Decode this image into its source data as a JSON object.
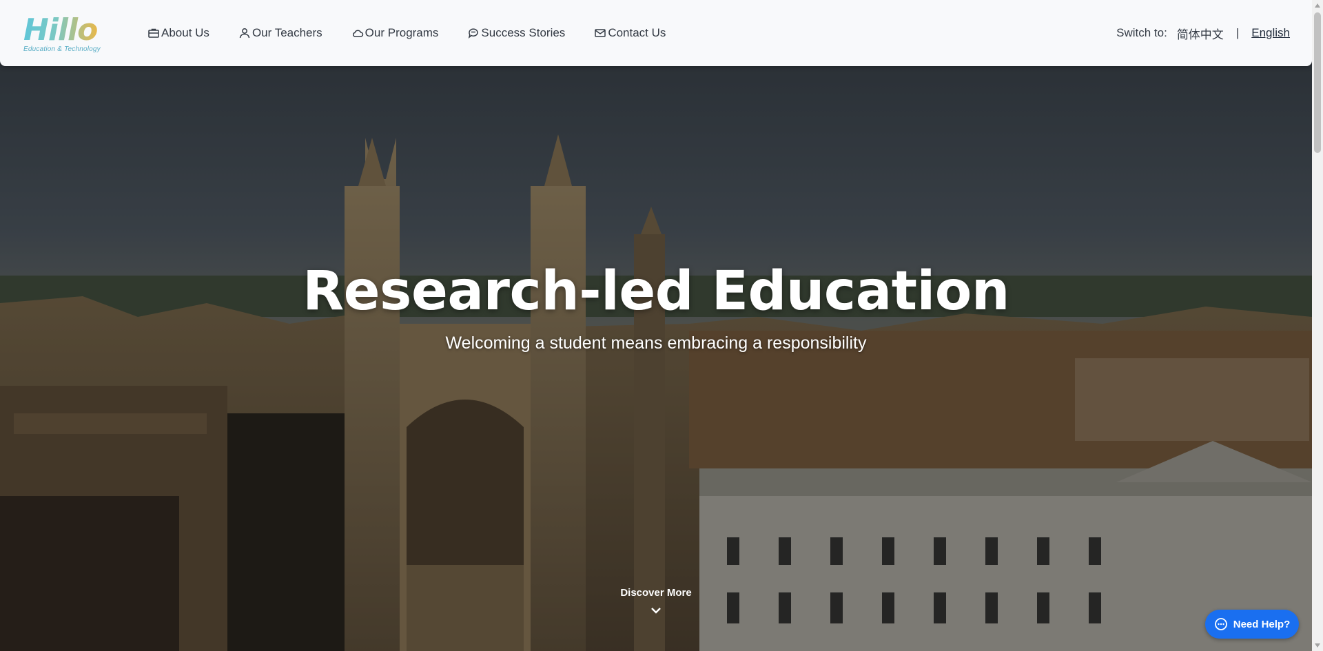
{
  "brand": {
    "name": "Hillo",
    "tagline": "Education & Technology"
  },
  "nav": {
    "items": [
      {
        "label": "About Us",
        "icon": "briefcase-icon"
      },
      {
        "label": "Our Teachers",
        "icon": "user-icon"
      },
      {
        "label": "Our Programs",
        "icon": "cloud-icon"
      },
      {
        "label": "Success Stories",
        "icon": "chat-bubble-icon"
      },
      {
        "label": "Contact Us",
        "icon": "envelope-icon"
      }
    ]
  },
  "language": {
    "prompt": "Switch to:",
    "chinese": "简体中文",
    "separator": "|",
    "english": "English",
    "active": "English"
  },
  "hero": {
    "title": "Research-led Education",
    "subtitle": "Welcoming a student means embracing a responsibility",
    "discover": "Discover More"
  },
  "help": {
    "label": "Need Help?"
  },
  "colors": {
    "help_button": "#1a6ff0",
    "nav_bg": "#f8f9fb",
    "nav_text": "#333a44",
    "logo_teal": "#5fc6d8",
    "logo_gold": "#e8b84a"
  }
}
